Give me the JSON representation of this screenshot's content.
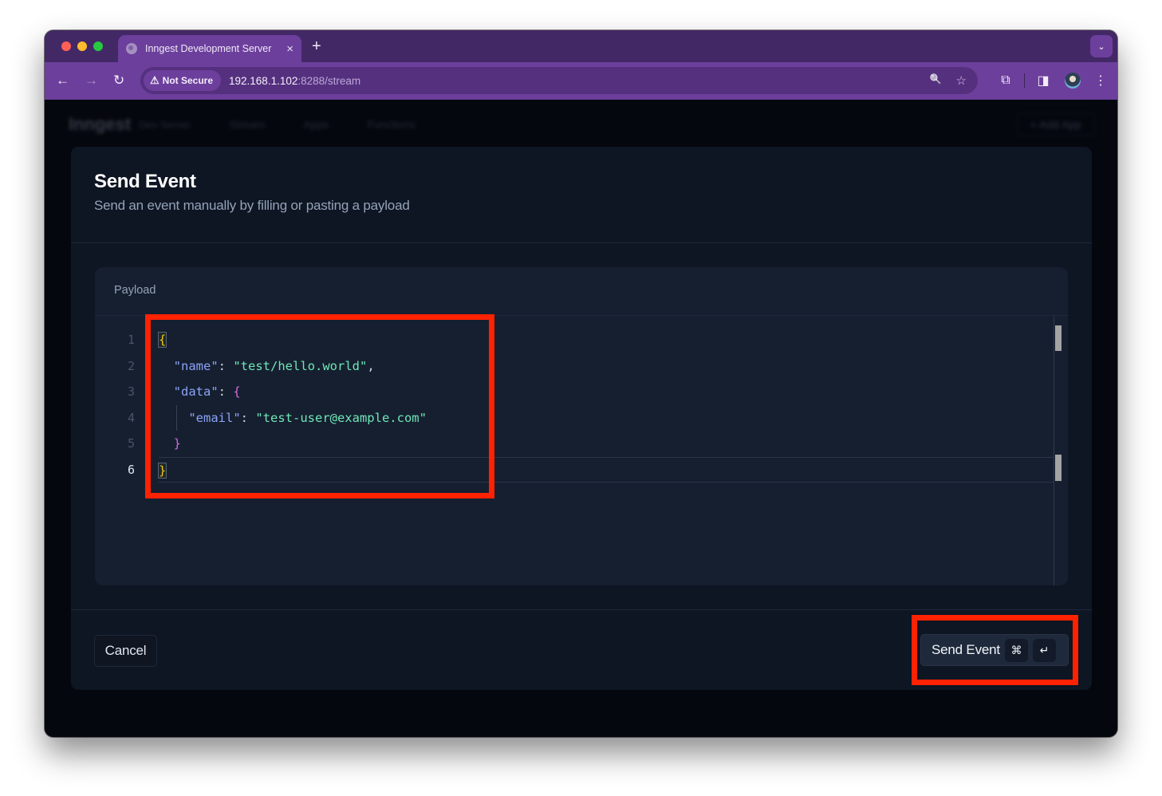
{
  "browser": {
    "tab_title": "Inngest Development Server",
    "tab_close_glyph": "×",
    "new_tab_glyph": "+",
    "tab_search_glyph": "⌄",
    "security_label": "Not Secure",
    "security_icon": "⚠",
    "url_host": "192.168.1.102",
    "url_path": ":8288/stream",
    "icons": {
      "back": "←",
      "forward": "→",
      "reload": "↻",
      "zoom": "🔍",
      "bookmark": "☆",
      "extensions": "⧉",
      "sidepanel": "◨",
      "menu": "⋮"
    }
  },
  "background_app": {
    "logo": "Inngest",
    "logo_sub": "Dev Server",
    "nav": [
      "Stream",
      "Apps",
      "Functions"
    ],
    "add_app": "+ Add App"
  },
  "modal": {
    "title": "Send Event",
    "subtitle": "Send an event manually by filling or pasting a payload",
    "payload_label": "Payload",
    "editor": {
      "line_numbers": [
        "1",
        "2",
        "3",
        "4",
        "5",
        "6"
      ],
      "active_line": 6,
      "lines": {
        "l1_open": "{",
        "l2_key": "\"name\"",
        "l2_sep": ": ",
        "l2_value": "\"test/hello.world\"",
        "l2_comma": ",",
        "l3_key": "\"data\"",
        "l3_sep": ": ",
        "l3_open": "{",
        "l4_key": "\"email\"",
        "l4_sep": ": ",
        "l4_value": "\"test-user@example.com\"",
        "l5_close": "}",
        "l6_close": "}"
      }
    },
    "cancel_label": "Cancel",
    "send_label": "Send Event",
    "send_shortcut": [
      "⌘",
      "↵"
    ]
  }
}
